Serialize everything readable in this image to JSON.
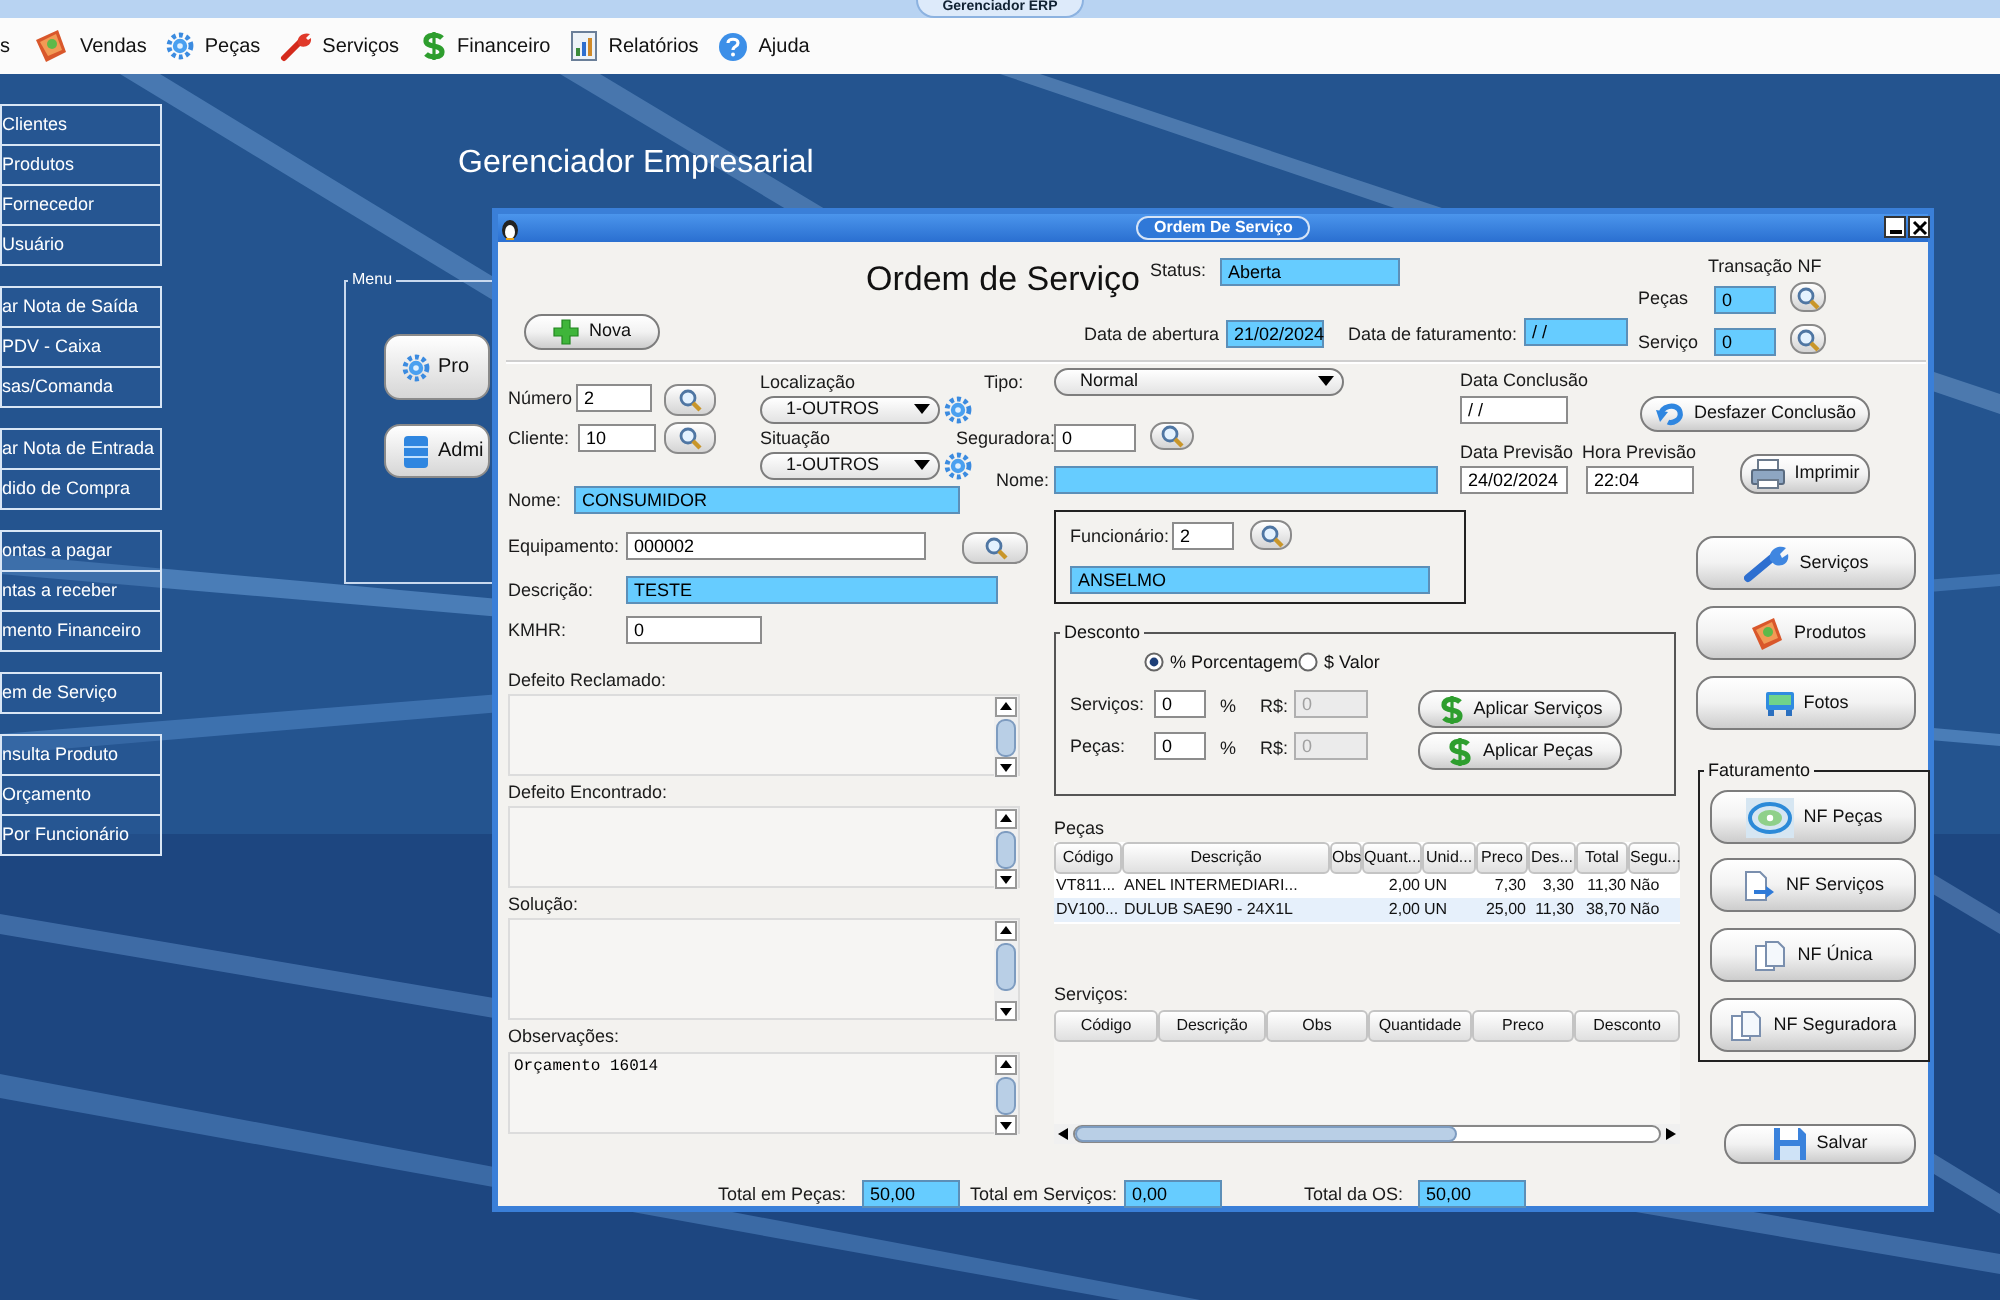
{
  "app_title": "Gerenciador ERP",
  "menu_bar": [
    "s",
    "Vendas",
    "Peças",
    "Serviços",
    "Financeiro",
    "Relatórios",
    "Ajuda"
  ],
  "sidebar": [
    {
      "items": [
        "Clientes",
        "Produtos",
        "Fornecedor",
        "Usuário"
      ]
    },
    {
      "items": [
        "ar Nota de Saída",
        "PDV - Caixa",
        "sas/Comanda"
      ]
    },
    {
      "items": [
        "ar Nota de Entrada",
        "dido de Compra"
      ]
    },
    {
      "items": [
        "ontas a pagar",
        "ntas a receber",
        "mento Financeiro"
      ]
    },
    {
      "items": [
        "em de Serviço"
      ]
    },
    {
      "items": [
        "nsulta Produto",
        "Orçamento",
        "Por Funcionário"
      ]
    }
  ],
  "desktop_title": "Gerenciador Empresarial",
  "menu_panel": {
    "title": "Menu",
    "buttons": [
      "Pro",
      "Admi"
    ]
  },
  "window": {
    "title": "Ordem De Serviço",
    "heading": "Ordem de Serviço",
    "status": {
      "label": "Status:",
      "value": "Aberta"
    },
    "transacao_nf": {
      "title": "Transação NF",
      "pecas_label": "Peças",
      "pecas_value": "0",
      "servico_label": "Serviço",
      "servico_value": "0"
    },
    "new_button": "Nova",
    "data_abertura": {
      "label": "Data de abertura",
      "value": "21/02/2024"
    },
    "data_faturamento": {
      "label": "Data de faturamento:",
      "value": "/ /"
    },
    "numero": {
      "label": "Número",
      "value": "2"
    },
    "cliente": {
      "label": "Cliente:",
      "value": "10"
    },
    "localizacao": {
      "label": "Localização",
      "value": "1-OUTROS"
    },
    "situacao": {
      "label": "Situação",
      "value": "1-OUTROS"
    },
    "tipo": {
      "label": "Tipo:",
      "value": "Normal"
    },
    "seguradora": {
      "label": "Seguradora:",
      "value": "0"
    },
    "seguradora_nome": {
      "label": "Nome:"
    },
    "data_conclusao": {
      "label": "Data Conclusão",
      "value": "/ /"
    },
    "desfazer_button": "Desfazer Conclusão",
    "data_previsao": {
      "label": "Data Previsão",
      "value": "24/02/2024"
    },
    "hora_previsao": {
      "label": "Hora Previsão",
      "value": "22:04"
    },
    "imprimir_button": "Imprimir",
    "nome": {
      "label": "Nome:",
      "value": "CONSUMIDOR"
    },
    "equipamento": {
      "label": "Equipamento:",
      "value": "000002"
    },
    "funcionario": {
      "label": "Funcionário:",
      "value": "2",
      "name": "ANSELMO"
    },
    "descricao": {
      "label": "Descrição:",
      "value": "TESTE"
    },
    "kmhr": {
      "label": "KMHR:",
      "value": "0"
    },
    "text_areas": [
      {
        "label": "Defeito Reclamado:"
      },
      {
        "label": "Defeito Encontrado:"
      },
      {
        "label": "Solução:"
      },
      {
        "label": "Observações:",
        "value": "Orçamento 16014"
      }
    ],
    "desconto": {
      "title": "Desconto",
      "modes": [
        {
          "label": "% Porcentagem",
          "selected": true
        },
        {
          "label": "$ Valor",
          "selected": false
        }
      ],
      "rows": [
        {
          "label": "Serviços:",
          "value": "0",
          "unit": "%",
          "money_label": "R$:",
          "money_value": "0",
          "money_disabled": true
        },
        {
          "label": "Peças:",
          "value": "0",
          "unit": "%",
          "money_label": "R$:",
          "money_value": "0",
          "money_disabled": true
        }
      ],
      "buttons": [
        "Aplicar Serviços",
        "Aplicar Peças"
      ]
    },
    "pecas_table": {
      "title": "Peças",
      "columns": [
        "Código",
        "Descrição",
        "Obs",
        "Quant...",
        "Unid...",
        "Preco",
        "Des...",
        "Total",
        "Segu..."
      ],
      "rows": [
        {
          "codigo": "VT811...",
          "descricao": "ANEL INTERMEDIARI...",
          "quantidade": "2,00",
          "unidade": "UN",
          "preco": "7,30",
          "desconto": "3,30",
          "total": "11,30",
          "seguradora": "Não",
          "selected": false
        },
        {
          "codigo": "DV100...",
          "descricao": "DULUB SAE90 - 24X1L",
          "quantidade": "2,00",
          "unidade": "UN",
          "preco": "25,00",
          "desconto": "11,30",
          "total": "38,70",
          "seguradora": "Não",
          "selected": true
        }
      ]
    },
    "servicos_table": {
      "title": "Serviços:",
      "columns": [
        "Código",
        "Descrição",
        "Obs",
        "Quantidade",
        "Preco",
        "Desconto"
      ]
    },
    "side_buttons": [
      "Serviços",
      "Produtos",
      "Fotos"
    ],
    "faturamento": {
      "title": "Faturamento",
      "buttons": [
        "NF Peças",
        "NF Serviços",
        "NF Única",
        "NF Seguradora"
      ]
    },
    "save_button": "Salvar",
    "totals": [
      {
        "label": "Total em Peças:",
        "value": "50,00"
      },
      {
        "label": "Total em Serviços:",
        "value": "0,00"
      },
      {
        "label": "Total da OS:",
        "value": "50,00"
      }
    ]
  }
}
